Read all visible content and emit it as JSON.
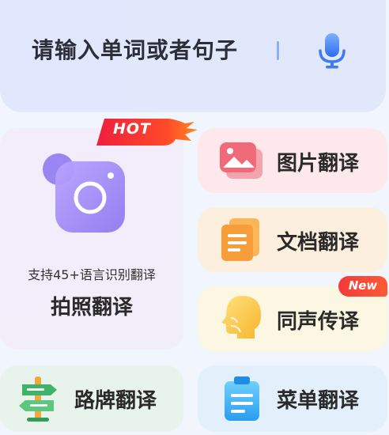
{
  "search": {
    "placeholder": "请输入单词或者句子",
    "mic_icon": "microphone-icon"
  },
  "photo_card": {
    "badge": "HOT",
    "icon": "camera-icon",
    "subtitle": "支持45+语言识别翻译",
    "title": "拍照翻译"
  },
  "tools": {
    "image": {
      "label": "图片翻译",
      "icon": "image-icon"
    },
    "document": {
      "label": "文档翻译",
      "icon": "document-icon"
    },
    "voice": {
      "label": "同声传译",
      "icon": "speaking-head-icon",
      "badge": "New"
    },
    "sign": {
      "label": "路牌翻译",
      "icon": "signpost-icon"
    },
    "menu": {
      "label": "菜单翻译",
      "icon": "menu-clipboard-icon"
    }
  },
  "colors": {
    "accent_blue": "#3f7cf4",
    "hot_red": "#f0323c",
    "new_red": "#f33a3a"
  }
}
